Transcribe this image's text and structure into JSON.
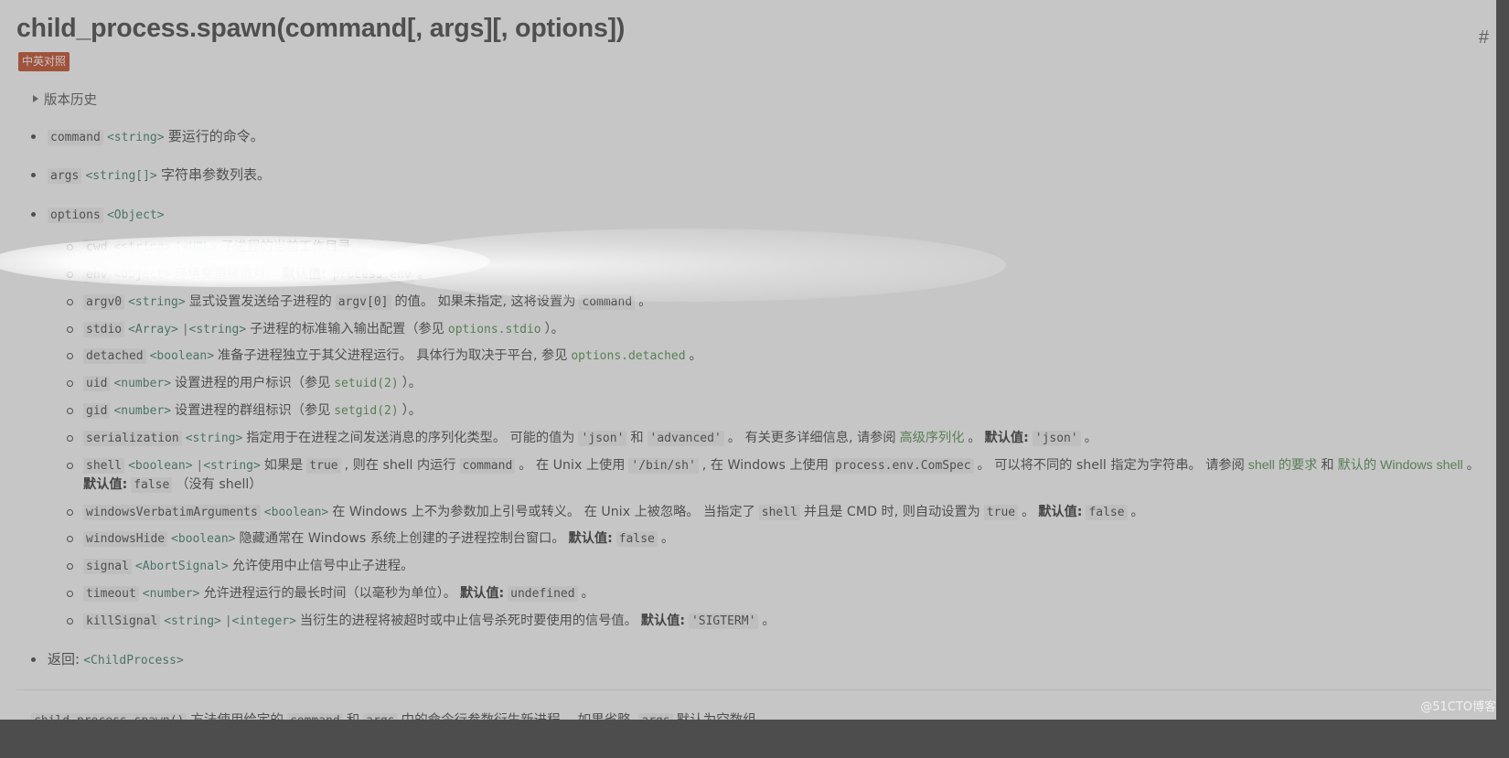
{
  "page": {
    "title": "child_process.spawn(command[, args][, options])",
    "anchor_symbol": "#",
    "badge_label": "中英对照",
    "history_label": "版本历史",
    "watermark": "@51CTO博客",
    "colors": {
      "badge_bg": "#c0380f",
      "link_green": "#43853d",
      "type_teal": "#2f6f5e",
      "text": "#333333",
      "code_bg": "rgba(0,0,0,0.055)",
      "overlay": "rgba(120,120,120,0.42)"
    }
  },
  "params": [
    {
      "name": "command",
      "types": [
        "<string>"
      ],
      "desc": "要运行的命令。"
    },
    {
      "name": "args",
      "types": [
        "<string[]>"
      ],
      "desc": "字符串参数列表。"
    },
    {
      "name": "options",
      "types": [
        "<Object>"
      ],
      "desc": ""
    }
  ],
  "options": [
    {
      "name": "cwd",
      "types": [
        "<string>",
        "<URL>"
      ],
      "desc_parts": [
        {
          "kind": "text",
          "text": "子进程的当前工作目录。"
        }
      ]
    },
    {
      "name": "env",
      "types": [
        "<Object>"
      ],
      "desc_parts": [
        {
          "kind": "text",
          "text": "环境变量键值对。"
        },
        {
          "kind": "default-label",
          "text": "默认值:"
        },
        {
          "kind": "code",
          "text": "process.env"
        },
        {
          "kind": "text",
          "text": "。"
        }
      ]
    },
    {
      "name": "argv0",
      "types": [
        "<string>"
      ],
      "desc_parts": [
        {
          "kind": "text",
          "text": "显式设置发送给子进程的"
        },
        {
          "kind": "code",
          "text": "argv[0]"
        },
        {
          "kind": "text",
          "text": "的值。 如果未指定, 这将设置为"
        },
        {
          "kind": "code",
          "text": "command"
        },
        {
          "kind": "text",
          "text": "。"
        }
      ]
    },
    {
      "name": "stdio",
      "types": [
        "<Array>",
        "<string>"
      ],
      "desc_parts": [
        {
          "kind": "text",
          "text": "子进程的标准输入输出配置（参见"
        },
        {
          "kind": "code-link",
          "text": "options.stdio"
        },
        {
          "kind": "text",
          "text": "）。"
        }
      ]
    },
    {
      "name": "detached",
      "types": [
        "<boolean>"
      ],
      "desc_parts": [
        {
          "kind": "text",
          "text": "准备子进程独立于其父进程运行。 具体行为取决于平台, 参见"
        },
        {
          "kind": "code-link",
          "text": "options.detached"
        },
        {
          "kind": "text",
          "text": "。"
        }
      ]
    },
    {
      "name": "uid",
      "types": [
        "<number>"
      ],
      "desc_parts": [
        {
          "kind": "text",
          "text": "设置进程的用户标识（参见"
        },
        {
          "kind": "code-link",
          "text": "setuid(2)"
        },
        {
          "kind": "text",
          "text": "）。"
        }
      ]
    },
    {
      "name": "gid",
      "types": [
        "<number>"
      ],
      "desc_parts": [
        {
          "kind": "text",
          "text": "设置进程的群组标识（参见"
        },
        {
          "kind": "code-link",
          "text": "setgid(2)"
        },
        {
          "kind": "text",
          "text": "）。"
        }
      ]
    },
    {
      "name": "serialization",
      "types": [
        "<string>"
      ],
      "desc_parts": [
        {
          "kind": "text",
          "text": "指定用于在进程之间发送消息的序列化类型。 可能的值为"
        },
        {
          "kind": "code",
          "text": "'json'"
        },
        {
          "kind": "text",
          "text": "和"
        },
        {
          "kind": "code",
          "text": "'advanced'"
        },
        {
          "kind": "text",
          "text": "。 有关更多详细信息, 请参阅"
        },
        {
          "kind": "link",
          "text": "高级序列化"
        },
        {
          "kind": "text",
          "text": "。"
        },
        {
          "kind": "default-label",
          "text": "默认值:"
        },
        {
          "kind": "code",
          "text": "'json'"
        },
        {
          "kind": "text",
          "text": "。"
        }
      ]
    },
    {
      "name": "shell",
      "types": [
        "<boolean>",
        "<string>"
      ],
      "desc_parts": [
        {
          "kind": "text",
          "text": "如果是"
        },
        {
          "kind": "code",
          "text": "true"
        },
        {
          "kind": "text",
          "text": ", 则在 shell 内运行"
        },
        {
          "kind": "code",
          "text": "command"
        },
        {
          "kind": "text",
          "text": "。 在 Unix 上使用"
        },
        {
          "kind": "code",
          "text": "'/bin/sh'"
        },
        {
          "kind": "text",
          "text": ", 在 Windows 上使用"
        },
        {
          "kind": "code",
          "text": "process.env.ComSpec"
        },
        {
          "kind": "text",
          "text": "。 可以将不同的 shell 指定为字符串。 请参阅"
        },
        {
          "kind": "link",
          "text": "shell 的要求"
        },
        {
          "kind": "text",
          "text": "和"
        },
        {
          "kind": "link",
          "text": "默认的 Windows shell"
        },
        {
          "kind": "text",
          "text": "。"
        },
        {
          "kind": "default-label",
          "text": "默认值:"
        },
        {
          "kind": "code",
          "text": "false"
        },
        {
          "kind": "text",
          "text": "（没有 shell）"
        }
      ]
    },
    {
      "name": "windowsVerbatimArguments",
      "types": [
        "<boolean>"
      ],
      "desc_parts": [
        {
          "kind": "text",
          "text": "在 Windows 上不为参数加上引号或转义。 在 Unix 上被忽略。 当指定了"
        },
        {
          "kind": "code",
          "text": "shell"
        },
        {
          "kind": "text",
          "text": "并且是 CMD 时, 则自动设置为"
        },
        {
          "kind": "code",
          "text": "true"
        },
        {
          "kind": "text",
          "text": "。"
        },
        {
          "kind": "default-label",
          "text": "默认值:"
        },
        {
          "kind": "code",
          "text": "false"
        },
        {
          "kind": "text",
          "text": "。"
        }
      ]
    },
    {
      "name": "windowsHide",
      "types": [
        "<boolean>"
      ],
      "desc_parts": [
        {
          "kind": "text",
          "text": "隐藏通常在 Windows 系统上创建的子进程控制台窗口。"
        },
        {
          "kind": "default-label",
          "text": "默认值:"
        },
        {
          "kind": "code",
          "text": "false"
        },
        {
          "kind": "text",
          "text": "。"
        }
      ]
    },
    {
      "name": "signal",
      "types": [
        "<AbortSignal>"
      ],
      "desc_parts": [
        {
          "kind": "text",
          "text": "允许使用中止信号中止子进程。"
        }
      ]
    },
    {
      "name": "timeout",
      "types": [
        "<number>"
      ],
      "desc_parts": [
        {
          "kind": "text",
          "text": "允许进程运行的最长时间（以毫秒为单位）。"
        },
        {
          "kind": "default-label",
          "text": "默认值:"
        },
        {
          "kind": "code",
          "text": "undefined"
        },
        {
          "kind": "text",
          "text": "。"
        }
      ]
    },
    {
      "name": "killSignal",
      "types": [
        "<string>",
        "<integer>"
      ],
      "desc_parts": [
        {
          "kind": "text",
          "text": "当衍生的进程将被超时或中止信号杀死时要使用的信号值。"
        },
        {
          "kind": "default-label",
          "text": "默认值:"
        },
        {
          "kind": "code",
          "text": "'SIGTERM'"
        },
        {
          "kind": "text",
          "text": "。"
        }
      ]
    }
  ],
  "returns": {
    "label": "返回:",
    "type": "<ChildProcess>"
  },
  "footer_paragraph": [
    {
      "kind": "code",
      "text": "child_process.spawn()"
    },
    {
      "kind": "text",
      "text": "方法使用给定的"
    },
    {
      "kind": "code",
      "text": "command"
    },
    {
      "kind": "text",
      "text": "和"
    },
    {
      "kind": "code",
      "text": "args"
    },
    {
      "kind": "text",
      "text": "中的命令行参数衍生新进程。 如果省略,"
    },
    {
      "kind": "code",
      "text": "args"
    },
    {
      "kind": "text",
      "text": "默认为空数组。"
    }
  ]
}
